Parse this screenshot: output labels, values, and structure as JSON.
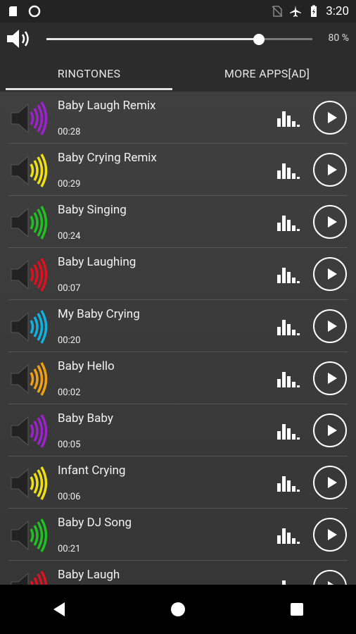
{
  "statusbar": {
    "time": "3:20",
    "icons": [
      "sd-card-icon",
      "circle-icon",
      "no-sim-icon",
      "airplane-icon",
      "battery-icon"
    ]
  },
  "volume": {
    "level_percent": 80,
    "label": "80 %",
    "icon": "speaker-icon"
  },
  "tabs": [
    {
      "label": "RINGTONES",
      "active": true
    },
    {
      "label": "MORE APPS[AD]",
      "active": false
    }
  ],
  "ringtones": [
    {
      "title": "Baby Laugh Remix",
      "duration": "00:28",
      "color": "#a020d0"
    },
    {
      "title": "Baby Crying Remix",
      "duration": "00:29",
      "color": "#f0e010"
    },
    {
      "title": "Baby Singing",
      "duration": "00:24",
      "color": "#20c020"
    },
    {
      "title": "Baby Laughing",
      "duration": "00:07",
      "color": "#e01020"
    },
    {
      "title": "My Baby Crying",
      "duration": "00:20",
      "color": "#10b0e0"
    },
    {
      "title": "Baby Hello",
      "duration": "00:02",
      "color": "#f0a010"
    },
    {
      "title": "Baby Baby",
      "duration": "00:05",
      "color": "#a020d0"
    },
    {
      "title": "Infant Crying",
      "duration": "00:06",
      "color": "#f0e010"
    },
    {
      "title": "Baby DJ Song",
      "duration": "00:21",
      "color": "#20c020"
    },
    {
      "title": "Baby Laugh",
      "duration": "",
      "color": "#e01020"
    }
  ],
  "navbar": {
    "buttons": [
      "back-button",
      "home-button",
      "recents-button"
    ]
  }
}
